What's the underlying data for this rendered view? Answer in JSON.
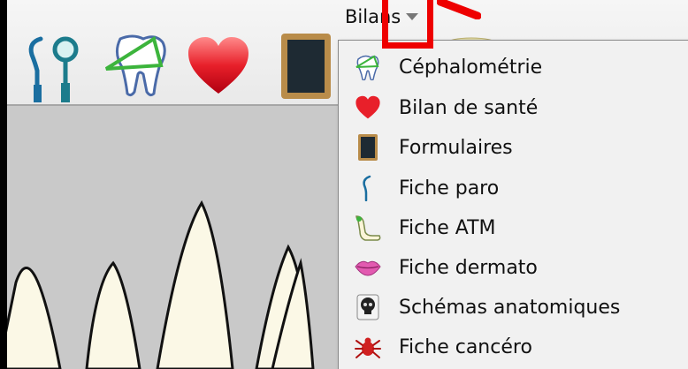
{
  "menu": {
    "title": "Bilans"
  },
  "toolbar": {
    "icons": [
      "dental-instruments-icon",
      "cephalometry-tooth-icon",
      "heart-icon",
      "forms-icon"
    ]
  },
  "dropdown": {
    "items": [
      {
        "label": "Céphalométrie",
        "icon": "cephalometry-icon"
      },
      {
        "label": "Bilan de santé",
        "icon": "heart-icon"
      },
      {
        "label": "Formulaires",
        "icon": "forms-icon"
      },
      {
        "label": "Fiche paro",
        "icon": "probe-icon"
      },
      {
        "label": "Fiche ATM",
        "icon": "jaw-icon"
      },
      {
        "label": "Fiche dermato",
        "icon": "lips-icon"
      },
      {
        "label": "Schémas anatomiques",
        "icon": "skull-icon"
      },
      {
        "label": "Fiche cancéro",
        "icon": "crab-icon"
      }
    ]
  },
  "colors": {
    "highlight": "#ee0000",
    "heart": "#e8202a",
    "teal": "#1c7c8c"
  }
}
